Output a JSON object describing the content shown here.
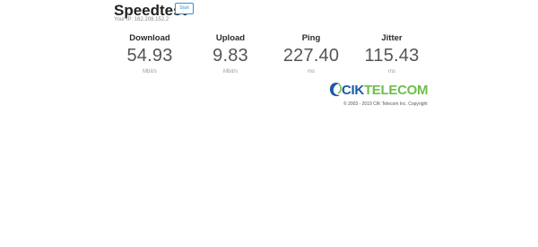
{
  "header": {
    "title": "Speedtest",
    "start_label": "Start",
    "ip_text": "Your IP: 162.208.152.2"
  },
  "metrics": [
    {
      "label": "Download",
      "value": "54.93",
      "unit": "Mbit/s"
    },
    {
      "label": "Upload",
      "value": "9.83",
      "unit": "Mbit/s"
    },
    {
      "label": "Ping",
      "value": "227.40",
      "unit": "ms"
    },
    {
      "label": "Jitter",
      "value": "115.43",
      "unit": "ms"
    }
  ],
  "footer": {
    "logo_text": "CIKTELECOM",
    "copyright": "© 2003 - 2019 CIK Telecom Inc. Copyright"
  },
  "colors": {
    "accent": "#3a8fd0",
    "logo_blue": "#1a5aa8",
    "logo_green": "#6cc04a"
  }
}
